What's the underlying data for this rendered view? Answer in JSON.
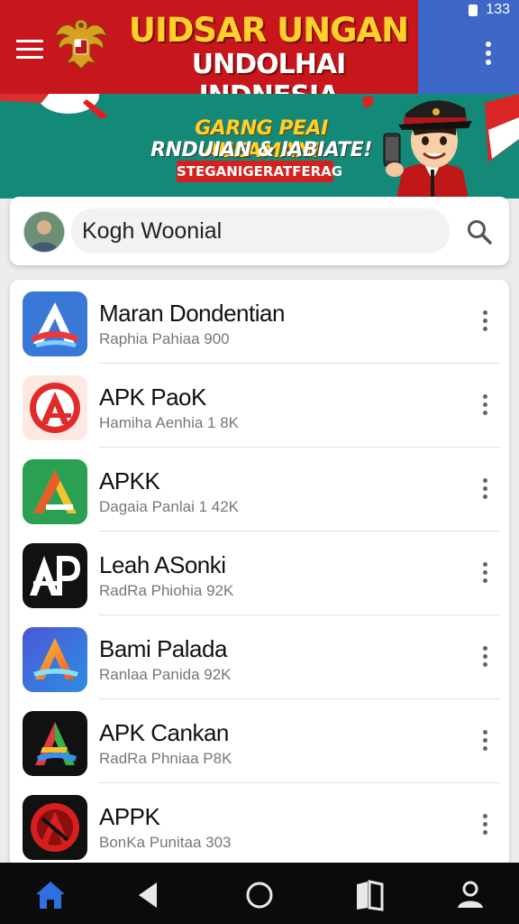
{
  "status_bar": {
    "time": "133"
  },
  "header": {
    "title_line1": "UIDSAR UNGAN",
    "title_line2": "UNDOLHAI INDNESIA"
  },
  "banner": {
    "line1": "GARNG PEAI AUEAMANI",
    "line2": "RNDUIAN & IABIATE!",
    "tag": "STEGANIGERATFERAG"
  },
  "search": {
    "value": "Kogh Woonial"
  },
  "apps": [
    {
      "name": "Maran Dondentian",
      "meta": "Raphia Pahiaa 900",
      "icon": "blue-a-icon"
    },
    {
      "name": "APK PaoK",
      "meta": "Hamiha Aenhia 1 8K",
      "icon": "red-a-circle-icon"
    },
    {
      "name": "APKK",
      "meta": "Dagaia Panlai 1 42K",
      "icon": "green-a-icon"
    },
    {
      "name": "Leah ASonki",
      "meta": "RadRa Phiohia 92K",
      "icon": "black-ap-icon"
    },
    {
      "name": "Bami Palada",
      "meta": "Ranlaa Panida 92K",
      "icon": "gradient-a-icon"
    },
    {
      "name": "APK Cankan",
      "meta": "RadRa Phniaa P8K",
      "icon": "colorful-a-icon"
    },
    {
      "name": "APPK",
      "meta": "BonKa Punitaa 303",
      "icon": "red-a-black-icon"
    }
  ],
  "colors": {
    "header_red": "#c8161d",
    "header_blue": "#3e68c8",
    "banner_teal": "#138a78",
    "nav_home_blue": "#2f6fe0"
  }
}
